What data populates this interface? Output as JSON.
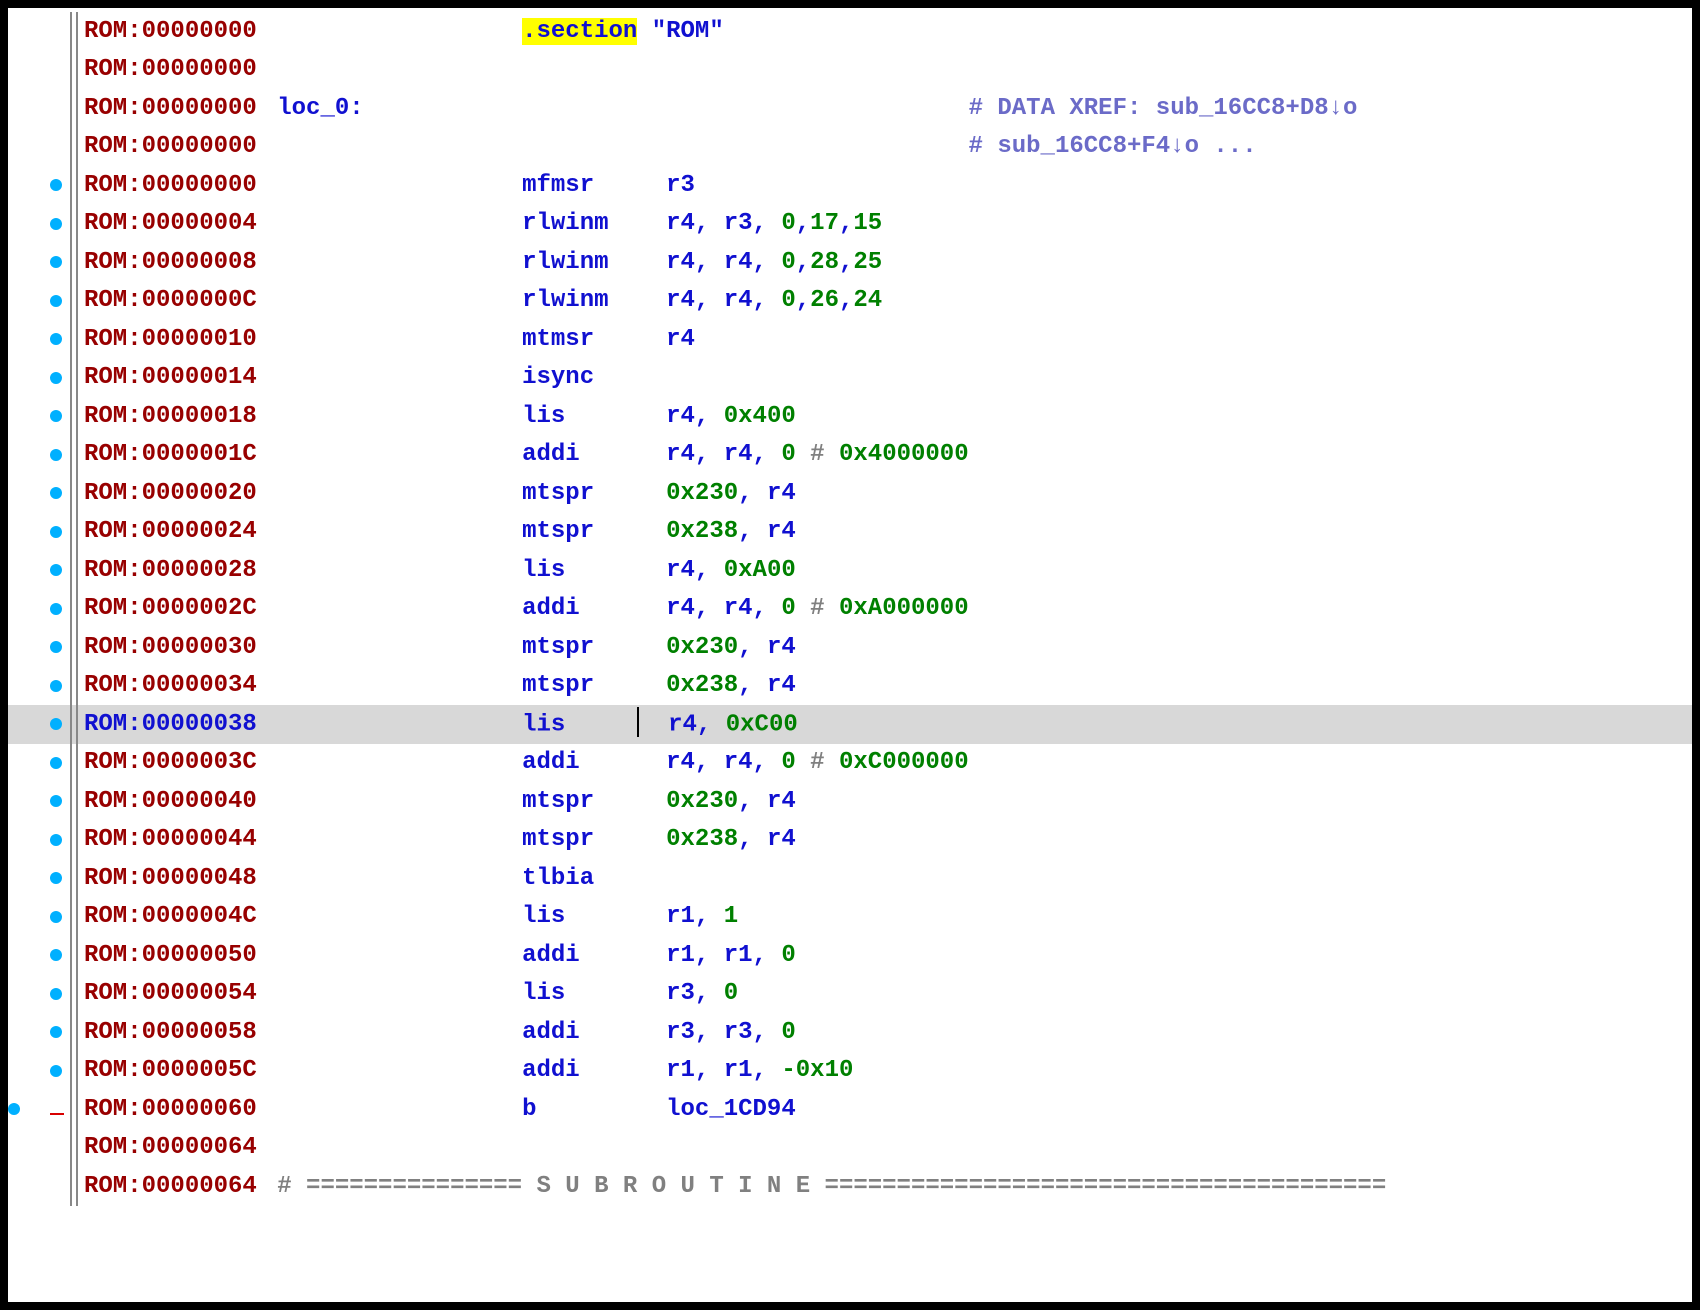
{
  "section_directive": ".section",
  "section_name": "\"ROM\"",
  "label": "loc_0:",
  "xref1": "# DATA XREF: sub_16CC8+D8↓o",
  "xref2": "# sub_16CC8+F4↓o ...",
  "subroutine_start": "# ",
  "subroutine_dashes": "===============",
  "subroutine_text": "S U B R O U T I N E",
  "lines": [
    {
      "addr": "ROM:00000000",
      "bp": false,
      "d": true
    },
    {
      "addr": "ROM:00000000",
      "bp": false
    },
    {
      "addr": "ROM:00000000",
      "bp": false,
      "lbl": true
    },
    {
      "addr": "ROM:00000000",
      "bp": false,
      "xr2": true
    },
    {
      "addr": "ROM:00000000",
      "bp": true,
      "mn": "mfmsr",
      "ops": [
        {
          "t": "reg",
          "v": "r3"
        }
      ]
    },
    {
      "addr": "ROM:00000004",
      "bp": true,
      "mn": "rlwinm",
      "ops": [
        {
          "t": "reg",
          "v": "r4"
        },
        {
          "t": "c"
        },
        {
          "t": "sp"
        },
        {
          "t": "reg",
          "v": "r3"
        },
        {
          "t": "c"
        },
        {
          "t": "sp"
        },
        {
          "t": "num",
          "v": "0"
        },
        {
          "t": "c"
        },
        {
          "t": "num",
          "v": "17"
        },
        {
          "t": "c"
        },
        {
          "t": "num",
          "v": "15"
        }
      ]
    },
    {
      "addr": "ROM:00000008",
      "bp": true,
      "mn": "rlwinm",
      "ops": [
        {
          "t": "reg",
          "v": "r4"
        },
        {
          "t": "c"
        },
        {
          "t": "sp"
        },
        {
          "t": "reg",
          "v": "r4"
        },
        {
          "t": "c"
        },
        {
          "t": "sp"
        },
        {
          "t": "num",
          "v": "0"
        },
        {
          "t": "c"
        },
        {
          "t": "num",
          "v": "28"
        },
        {
          "t": "c"
        },
        {
          "t": "num",
          "v": "25"
        }
      ]
    },
    {
      "addr": "ROM:0000000C",
      "bp": true,
      "mn": "rlwinm",
      "ops": [
        {
          "t": "reg",
          "v": "r4"
        },
        {
          "t": "c"
        },
        {
          "t": "sp"
        },
        {
          "t": "reg",
          "v": "r4"
        },
        {
          "t": "c"
        },
        {
          "t": "sp"
        },
        {
          "t": "num",
          "v": "0"
        },
        {
          "t": "c"
        },
        {
          "t": "num",
          "v": "26"
        },
        {
          "t": "c"
        },
        {
          "t": "num",
          "v": "24"
        }
      ]
    },
    {
      "addr": "ROM:00000010",
      "bp": true,
      "mn": "mtmsr",
      "ops": [
        {
          "t": "reg",
          "v": "r4"
        }
      ]
    },
    {
      "addr": "ROM:00000014",
      "bp": true,
      "mn": "isync",
      "ops": []
    },
    {
      "addr": "ROM:00000018",
      "bp": true,
      "mn": "lis",
      "ops": [
        {
          "t": "reg",
          "v": "r4"
        },
        {
          "t": "c"
        },
        {
          "t": "sp"
        },
        {
          "t": "num",
          "v": "0x400"
        }
      ]
    },
    {
      "addr": "ROM:0000001C",
      "bp": true,
      "mn": "addi",
      "ops": [
        {
          "t": "reg",
          "v": "r4"
        },
        {
          "t": "c"
        },
        {
          "t": "sp"
        },
        {
          "t": "reg",
          "v": "r4"
        },
        {
          "t": "c"
        },
        {
          "t": "sp"
        },
        {
          "t": "num",
          "v": "0"
        }
      ],
      "cmt": "0x4000000"
    },
    {
      "addr": "ROM:00000020",
      "bp": true,
      "mn": "mtspr",
      "ops": [
        {
          "t": "num",
          "v": "0x230"
        },
        {
          "t": "c"
        },
        {
          "t": "sp"
        },
        {
          "t": "reg",
          "v": "r4"
        }
      ]
    },
    {
      "addr": "ROM:00000024",
      "bp": true,
      "mn": "mtspr",
      "ops": [
        {
          "t": "num",
          "v": "0x238"
        },
        {
          "t": "c"
        },
        {
          "t": "sp"
        },
        {
          "t": "reg",
          "v": "r4"
        }
      ]
    },
    {
      "addr": "ROM:00000028",
      "bp": true,
      "mn": "lis",
      "ops": [
        {
          "t": "reg",
          "v": "r4"
        },
        {
          "t": "c"
        },
        {
          "t": "sp"
        },
        {
          "t": "num",
          "v": "0xA00"
        }
      ]
    },
    {
      "addr": "ROM:0000002C",
      "bp": true,
      "mn": "addi",
      "ops": [
        {
          "t": "reg",
          "v": "r4"
        },
        {
          "t": "c"
        },
        {
          "t": "sp"
        },
        {
          "t": "reg",
          "v": "r4"
        },
        {
          "t": "c"
        },
        {
          "t": "sp"
        },
        {
          "t": "num",
          "v": "0"
        }
      ],
      "cmt": "0xA000000"
    },
    {
      "addr": "ROM:00000030",
      "bp": true,
      "mn": "mtspr",
      "ops": [
        {
          "t": "num",
          "v": "0x230"
        },
        {
          "t": "c"
        },
        {
          "t": "sp"
        },
        {
          "t": "reg",
          "v": "r4"
        }
      ]
    },
    {
      "addr": "ROM:00000034",
      "bp": true,
      "mn": "mtspr",
      "ops": [
        {
          "t": "num",
          "v": "0x238"
        },
        {
          "t": "c"
        },
        {
          "t": "sp"
        },
        {
          "t": "reg",
          "v": "r4"
        }
      ]
    },
    {
      "addr": "ROM:00000038",
      "bp": true,
      "sel": true,
      "mn": "lis",
      "ops": [
        {
          "t": "reg",
          "v": "r4"
        },
        {
          "t": "c"
        },
        {
          "t": "sp"
        },
        {
          "t": "num",
          "v": "0xC00"
        }
      ]
    },
    {
      "addr": "ROM:0000003C",
      "bp": true,
      "mn": "addi",
      "ops": [
        {
          "t": "reg",
          "v": "r4"
        },
        {
          "t": "c"
        },
        {
          "t": "sp"
        },
        {
          "t": "reg",
          "v": "r4"
        },
        {
          "t": "c"
        },
        {
          "t": "sp"
        },
        {
          "t": "num",
          "v": "0"
        }
      ],
      "cmt": "0xC000000"
    },
    {
      "addr": "ROM:00000040",
      "bp": true,
      "mn": "mtspr",
      "ops": [
        {
          "t": "num",
          "v": "0x230"
        },
        {
          "t": "c"
        },
        {
          "t": "sp"
        },
        {
          "t": "reg",
          "v": "r4"
        }
      ]
    },
    {
      "addr": "ROM:00000044",
      "bp": true,
      "mn": "mtspr",
      "ops": [
        {
          "t": "num",
          "v": "0x238"
        },
        {
          "t": "c"
        },
        {
          "t": "sp"
        },
        {
          "t": "reg",
          "v": "r4"
        }
      ]
    },
    {
      "addr": "ROM:00000048",
      "bp": true,
      "mn": "tlbia",
      "ops": []
    },
    {
      "addr": "ROM:0000004C",
      "bp": true,
      "mn": "lis",
      "ops": [
        {
          "t": "reg",
          "v": "r1"
        },
        {
          "t": "c"
        },
        {
          "t": "sp"
        },
        {
          "t": "num",
          "v": "1"
        }
      ]
    },
    {
      "addr": "ROM:00000050",
      "bp": true,
      "mn": "addi",
      "ops": [
        {
          "t": "reg",
          "v": "r1"
        },
        {
          "t": "c"
        },
        {
          "t": "sp"
        },
        {
          "t": "reg",
          "v": "r1"
        },
        {
          "t": "c"
        },
        {
          "t": "sp"
        },
        {
          "t": "num",
          "v": "0"
        }
      ]
    },
    {
      "addr": "ROM:00000054",
      "bp": true,
      "mn": "lis",
      "ops": [
        {
          "t": "reg",
          "v": "r3"
        },
        {
          "t": "c"
        },
        {
          "t": "sp"
        },
        {
          "t": "num",
          "v": "0"
        }
      ]
    },
    {
      "addr": "ROM:00000058",
      "bp": true,
      "mn": "addi",
      "ops": [
        {
          "t": "reg",
          "v": "r3"
        },
        {
          "t": "c"
        },
        {
          "t": "sp"
        },
        {
          "t": "reg",
          "v": "r3"
        },
        {
          "t": "c"
        },
        {
          "t": "sp"
        },
        {
          "t": "num",
          "v": "0"
        }
      ]
    },
    {
      "addr": "ROM:0000005C",
      "bp": true,
      "mn": "addi",
      "ops": [
        {
          "t": "reg",
          "v": "r1"
        },
        {
          "t": "c"
        },
        {
          "t": "sp"
        },
        {
          "t": "reg",
          "v": "r1"
        },
        {
          "t": "c"
        },
        {
          "t": "sp"
        },
        {
          "t": "num",
          "v": "-0x10"
        }
      ]
    },
    {
      "addr": "ROM:00000060",
      "bp": true,
      "mn": "b",
      "ops": [
        {
          "t": "reg",
          "v": "loc_1CD94"
        }
      ],
      "red": true
    },
    {
      "addr": "ROM:00000064",
      "bp": false,
      "red": true
    },
    {
      "addr": "ROM:00000064",
      "bp": false,
      "sub": true,
      "red": true
    }
  ]
}
